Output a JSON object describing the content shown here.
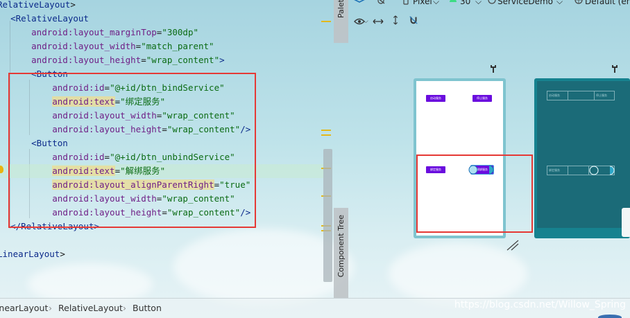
{
  "editor": {
    "lines": [
      {
        "indent": "",
        "segments": [
          {
            "t": "RelativeLayout",
            "c": "tag"
          },
          {
            "t": ">",
            "c": "punct"
          }
        ]
      },
      {
        "indent": "  ",
        "segments": [
          {
            "t": "<RelativeLayout",
            "c": "tag"
          }
        ]
      },
      {
        "indent": "      ",
        "segments": [
          {
            "t": "android:layout_marginTop",
            "c": "attr"
          },
          {
            "t": "=",
            "c": "punct"
          },
          {
            "t": "\"300dp\"",
            "c": "val"
          }
        ]
      },
      {
        "indent": "      ",
        "segments": [
          {
            "t": "android:layout_width",
            "c": "attr"
          },
          {
            "t": "=",
            "c": "punct"
          },
          {
            "t": "\"match_parent\"",
            "c": "val"
          }
        ]
      },
      {
        "indent": "      ",
        "segments": [
          {
            "t": "android:layout_height",
            "c": "attr"
          },
          {
            "t": "=",
            "c": "punct"
          },
          {
            "t": "\"wrap_content\"",
            "c": "val"
          },
          {
            "t": ">",
            "c": "tag"
          }
        ]
      },
      {
        "indent": "      ",
        "segments": [
          {
            "t": "<Button",
            "c": "tag"
          }
        ]
      },
      {
        "indent": "          ",
        "segments": [
          {
            "t": "android:id",
            "c": "attr"
          },
          {
            "t": "=",
            "c": "punct"
          },
          {
            "t": "\"@+id/btn_bindService\"",
            "c": "val"
          }
        ]
      },
      {
        "indent": "          ",
        "segments": [
          {
            "t": "android:text",
            "c": "attr hl-attr"
          },
          {
            "t": "=",
            "c": "punct"
          },
          {
            "t": "\"绑定服务\"",
            "c": "val"
          }
        ]
      },
      {
        "indent": "          ",
        "segments": [
          {
            "t": "android:layout_width",
            "c": "attr"
          },
          {
            "t": "=",
            "c": "punct"
          },
          {
            "t": "\"wrap_content\"",
            "c": "val"
          }
        ]
      },
      {
        "indent": "          ",
        "segments": [
          {
            "t": "android:layout_height",
            "c": "attr"
          },
          {
            "t": "=",
            "c": "punct"
          },
          {
            "t": "\"wrap_content\"",
            "c": "val"
          },
          {
            "t": "/>",
            "c": "tag"
          }
        ]
      },
      {
        "indent": "      ",
        "segments": [
          {
            "t": "<Button",
            "c": "tag"
          }
        ]
      },
      {
        "indent": "          ",
        "segments": [
          {
            "t": "android:id",
            "c": "attr"
          },
          {
            "t": "=",
            "c": "punct"
          },
          {
            "t": "\"@+id/btn_unbindService\"",
            "c": "val"
          }
        ]
      },
      {
        "indent": "          ",
        "current": true,
        "segments": [
          {
            "t": "android:text",
            "c": "attr hl-attr"
          },
          {
            "t": "=",
            "c": "punct"
          },
          {
            "t": "\"解绑服务\"",
            "c": "val"
          }
        ]
      },
      {
        "indent": "          ",
        "segments": [
          {
            "t": "android:layout_alignParentRight",
            "c": "attr hl-attr"
          },
          {
            "t": "=",
            "c": "punct"
          },
          {
            "t": "\"true\"",
            "c": "val"
          }
        ]
      },
      {
        "indent": "          ",
        "segments": [
          {
            "t": "android:layout_width",
            "c": "attr"
          },
          {
            "t": "=",
            "c": "punct"
          },
          {
            "t": "\"wrap_content\"",
            "c": "val"
          }
        ]
      },
      {
        "indent": "          ",
        "segments": [
          {
            "t": "android:layout_height",
            "c": "attr"
          },
          {
            "t": "=",
            "c": "punct"
          },
          {
            "t": "\"wrap_content\"",
            "c": "val"
          },
          {
            "t": "/>",
            "c": "tag"
          }
        ]
      },
      {
        "indent": "  ",
        "segments": [
          {
            "t": "</RelativeLayout>",
            "c": "tag"
          }
        ]
      },
      {
        "indent": "",
        "segments": [
          {
            "t": "",
            "c": "punct"
          }
        ]
      },
      {
        "indent": "",
        "segments": [
          {
            "t": "LinearLayout",
            "c": "tag"
          },
          {
            "t": ">",
            "c": "punct"
          }
        ]
      }
    ]
  },
  "side_panels": {
    "palette_label": "Palette",
    "component_tree_label": "Component Tree"
  },
  "toolbar": {
    "device": "Pixel",
    "api": "30",
    "activity": "ServiceDemo",
    "theme": "Default (en"
  },
  "preview": {
    "design_buttons": {
      "start": "启动服务",
      "stop": "停止服务",
      "bind": "绑定服务",
      "unbind": "解绑服务"
    },
    "blueprint_labels": {
      "start": "启动服务",
      "stop": "停止服务",
      "bind": "绑定服务"
    }
  },
  "breadcrumb": {
    "items": [
      "LinearLayout",
      "RelativeLayout",
      "Button"
    ]
  },
  "watermark": "https://blog.csdn.net/Willow_Spring",
  "colors": {
    "tag": "#0b2a8a",
    "attribute": "#6f1f86",
    "value": "#0b6b13",
    "selection": "#e53935",
    "button": "#6a0dde",
    "blueprint": "#1b6b78"
  }
}
